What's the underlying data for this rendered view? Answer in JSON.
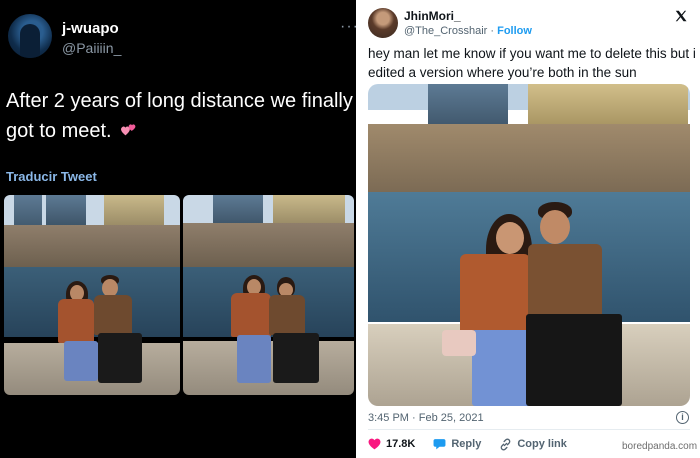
{
  "left_tweet": {
    "display_name": "j-wuapo",
    "handle": "@Paiiiin_",
    "more_glyph": "···",
    "text": "After 2 years of long distance we finally got to meet.",
    "emoji_icon": "two-hearts-icon",
    "translate_label": "Traducir Tweet",
    "photos": [
      "photo-1",
      "photo-2"
    ]
  },
  "right_tweet": {
    "display_name": "JhinMori_",
    "handle": "@The_Crosshair",
    "separator": " · ",
    "follow_label": "Follow",
    "text": "hey man let me know if you want me to delete this but i edited a version where you’re both in the sun",
    "timestamp": "3:45 PM · Feb 25, 2021",
    "actions": {
      "likes": "17.8K",
      "reply_label": "Reply",
      "copy_link_label": "Copy link"
    }
  },
  "credit": "boredpanda.com",
  "colors": {
    "dark_bg": "#000000",
    "light_bg": "#ffffff",
    "link_blue": "#1d9bf0",
    "heart_pink": "#f91880"
  }
}
